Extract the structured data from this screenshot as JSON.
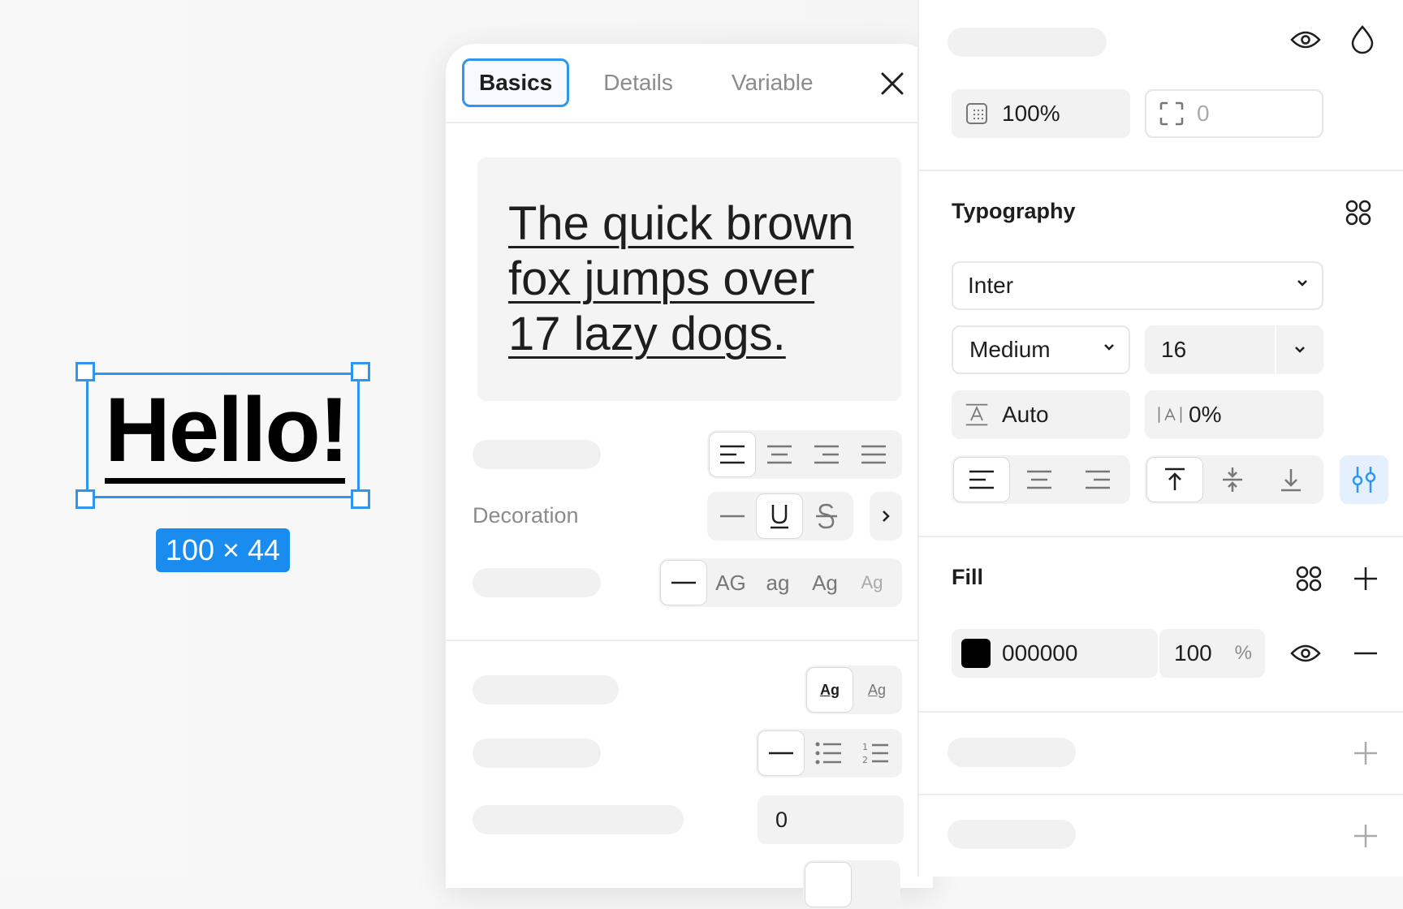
{
  "canvas": {
    "layer_text": "Hello!",
    "dimensions_badge": "100 × 44"
  },
  "popover": {
    "tabs": [
      {
        "label": "Basics",
        "active": true
      },
      {
        "label": "Details",
        "active": false
      },
      {
        "label": "Variable",
        "active": false
      }
    ],
    "preview_lines": [
      "The quick brown",
      "fox jumps over",
      "17 lazy dogs."
    ],
    "decoration_label": "Decoration",
    "case_options": [
      "AG",
      "ag",
      "Ag",
      "Ag"
    ],
    "lettercase_sample": "Ag",
    "paragraph_indent_value": "0"
  },
  "panel": {
    "opacity_value": "100%",
    "corner_placeholder": "0",
    "typography": {
      "title": "Typography",
      "font_family": "Inter",
      "font_weight": "Medium",
      "font_size": "16",
      "line_height": "Auto",
      "letter_spacing": "0%"
    },
    "fill": {
      "title": "Fill",
      "hex": "000000",
      "opacity": "100",
      "percent_sign": "%",
      "color": "#000000"
    }
  },
  "colors": {
    "accent": "#2e96ee",
    "badge": "#1a8cf0",
    "active_toggle_bg": "#e4f0fd"
  }
}
